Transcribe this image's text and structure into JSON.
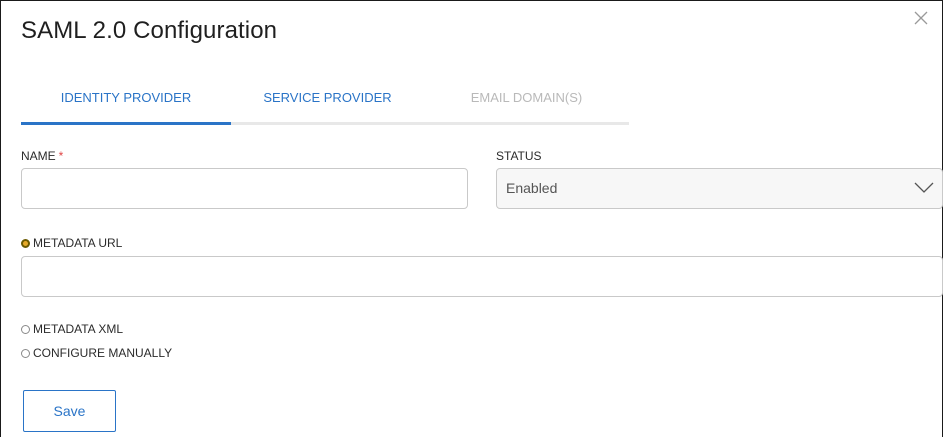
{
  "dialog": {
    "title": "SAML 2.0 Configuration",
    "close_icon": "close-icon"
  },
  "tabs": [
    {
      "label": "IDENTITY PROVIDER",
      "active": true
    },
    {
      "label": "SERVICE PROVIDER",
      "active": false
    },
    {
      "label": "EMAIL DOMAIN(S)",
      "disabled": true
    }
  ],
  "form": {
    "name_label": "NAME",
    "required_mark": "*",
    "name_value": "",
    "status_label": "STATUS",
    "status_value": "Enabled",
    "status_chevron_icon": "chevron-down-icon",
    "metadata_url_label": "METADATA URL",
    "metadata_url_value": "",
    "metadata_xml_label": "METADATA XML",
    "configure_manually_label": "CONFIGURE MANUALLY",
    "selected_option": "METADATA URL"
  },
  "actions": {
    "save_label": "Save"
  },
  "colors": {
    "accent": "#2a74c7",
    "required": "#e04545",
    "radio_selected": "#e6a92a",
    "tab_disabled": "#b9b9b9"
  }
}
